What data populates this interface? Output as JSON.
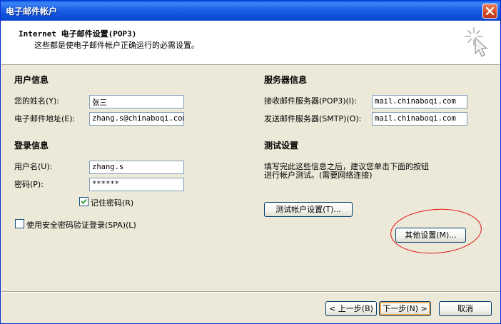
{
  "window": {
    "title": "电子邮件帐户"
  },
  "header": {
    "title": "Internet 电子邮件设置(POP3)",
    "subtitle": "这些都是使电子邮件帐户正确运行的必需设置。"
  },
  "user_info": {
    "section_title": "用户信息",
    "name_label": "您的姓名(Y):",
    "name_value": "张三",
    "email_label": "电子邮件地址(E):",
    "email_value": "zhang.s@chinaboqi.com"
  },
  "login_info": {
    "section_title": "登录信息",
    "username_label": "用户名(U):",
    "username_value": "zhang.s",
    "password_label": "密码(P):",
    "password_value": "******",
    "remember_label": "记住密码(R)",
    "remember_checked": true,
    "spa_label": "使用安全密码验证登录(SPA)(L)",
    "spa_checked": false
  },
  "server_info": {
    "section_title": "服务器信息",
    "incoming_label": "接收邮件服务器(POP3)(I):",
    "incoming_value": "mail.chinaboqi.com",
    "outgoing_label": "发送邮件服务器(SMTP)(O):",
    "outgoing_value": "mail.chinaboqi.com"
  },
  "test_settings": {
    "section_title": "测试设置",
    "description_line1": "填写完此这些信息之后，建议您单击下面的按钮",
    "description_line2": "进行帐户测试。(需要网络连接)",
    "test_button": "测试帐户设置(T)...",
    "more_button": "其他设置(M)..."
  },
  "footer": {
    "back_button": "< 上一步(B)",
    "next_button": "下一步(N) >",
    "cancel_button": "取消"
  },
  "colors": {
    "titlebar": "#0a5de8",
    "window_bg": "#ece9d8",
    "annotation": "#e01010"
  },
  "icons": [
    "close-icon",
    "wizard-cursor-icon",
    "checkmark-icon"
  ]
}
